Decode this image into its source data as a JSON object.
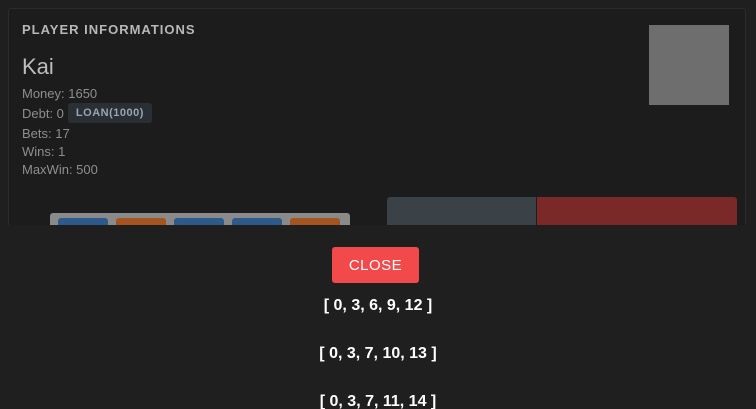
{
  "player": {
    "section_title": "PLAYER INFORMATIONS",
    "name": "Kai",
    "money": "Money: 1650",
    "debt": "Debt: 0",
    "loan_button": "LOAN(1000)",
    "bets": "Bets: 17",
    "wins": "Wins: 1",
    "maxwin": "MaxWin: 500"
  },
  "modal": {
    "close_label": "CLOSE",
    "patterns": [
      "[ 0, 3, 6, 9, 12 ]",
      "[ 0, 3, 7, 10, 13 ]",
      "[ 0, 3, 7, 11, 14 ]"
    ]
  },
  "colors": {
    "close_button": "#f24a4a",
    "reel_blue": "#2d5a8a",
    "reel_orange": "#a5541f",
    "action_right": "#7a2828",
    "action_left": "#3a4247"
  }
}
